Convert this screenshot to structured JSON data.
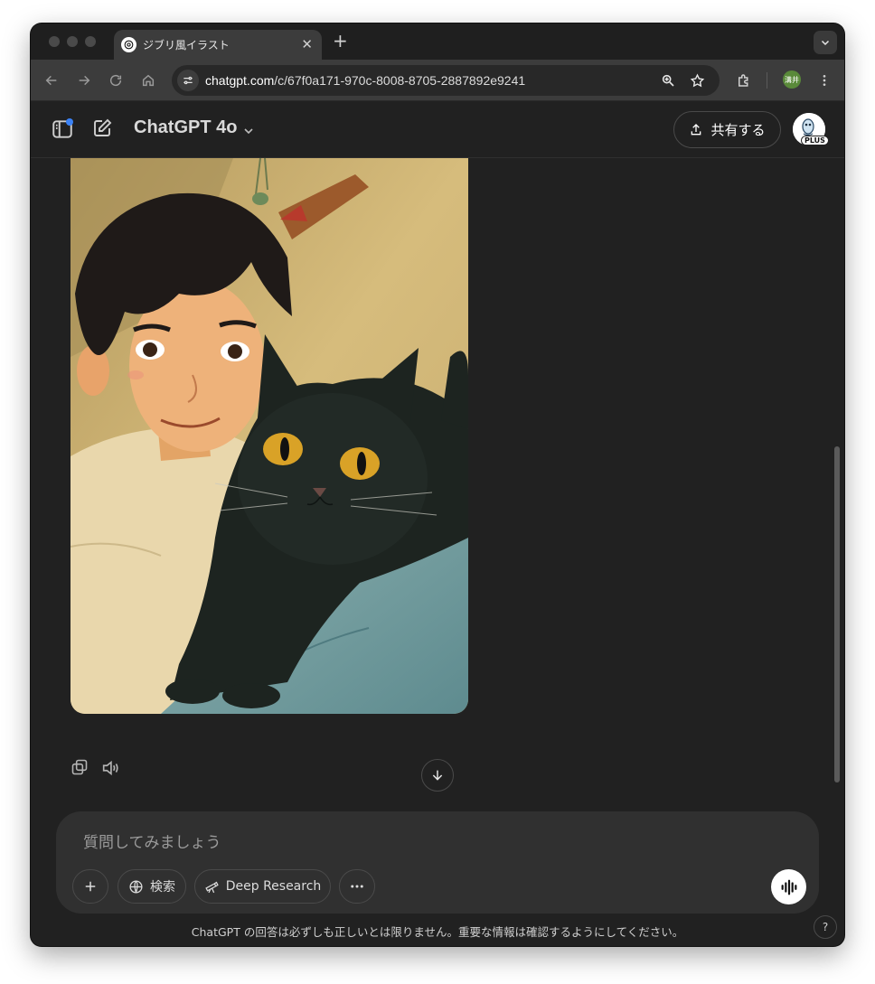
{
  "browser": {
    "tab": {
      "title": "ジブリ風イラスト",
      "close_glyph": "✕"
    },
    "new_tab_glyph": "+",
    "url_host": "chatgpt.com",
    "url_path": "/c/67f0a171-970c-8008-8705-2887892e9241",
    "profile_initials": "溝井"
  },
  "app": {
    "model_name": "ChatGPT 4o",
    "share_label": "共有する",
    "plus_badge": "PLUS"
  },
  "composer": {
    "placeholder": "質問してみましょう",
    "search_label": "検索",
    "deep_research_label": "Deep Research"
  },
  "disclaimer": "ChatGPT の回答は必ずしも正しいとは限りません。重要な情報は確認するようにしてください。",
  "help_glyph": "?",
  "colors": {
    "background": "#212121",
    "composer": "#303030",
    "accent_dot": "#3b82f6",
    "cat_eye": "#d9a227"
  },
  "icons": [
    "sidebar-toggle-icon",
    "new-chat-icon",
    "share-icon",
    "copy-icon",
    "speaker-icon",
    "arrow-down-icon",
    "plus-icon",
    "globe-icon",
    "telescope-icon",
    "more-icon",
    "voice-wave-icon"
  ]
}
